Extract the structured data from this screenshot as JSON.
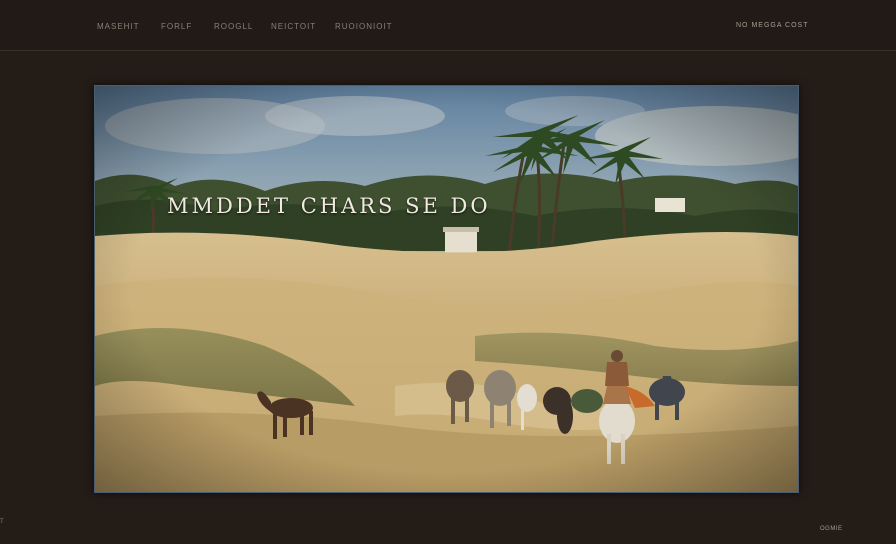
{
  "nav": {
    "items": [
      {
        "label": "MASEHIT"
      },
      {
        "label": "FORLF"
      },
      {
        "label": "ROOGLL"
      },
      {
        "label": "NEICTOIT"
      },
      {
        "label": "RUOIONIOIT"
      }
    ],
    "right_label": "NO MEGGA COST"
  },
  "hero": {
    "title": "MMDDET CHARS SE DO"
  },
  "corner_left": "T",
  "footer_right": "OGMIE",
  "colors": {
    "page_background": "#241c17",
    "nav_text": "#8b7f74",
    "hero_border": "#4a5d73"
  }
}
